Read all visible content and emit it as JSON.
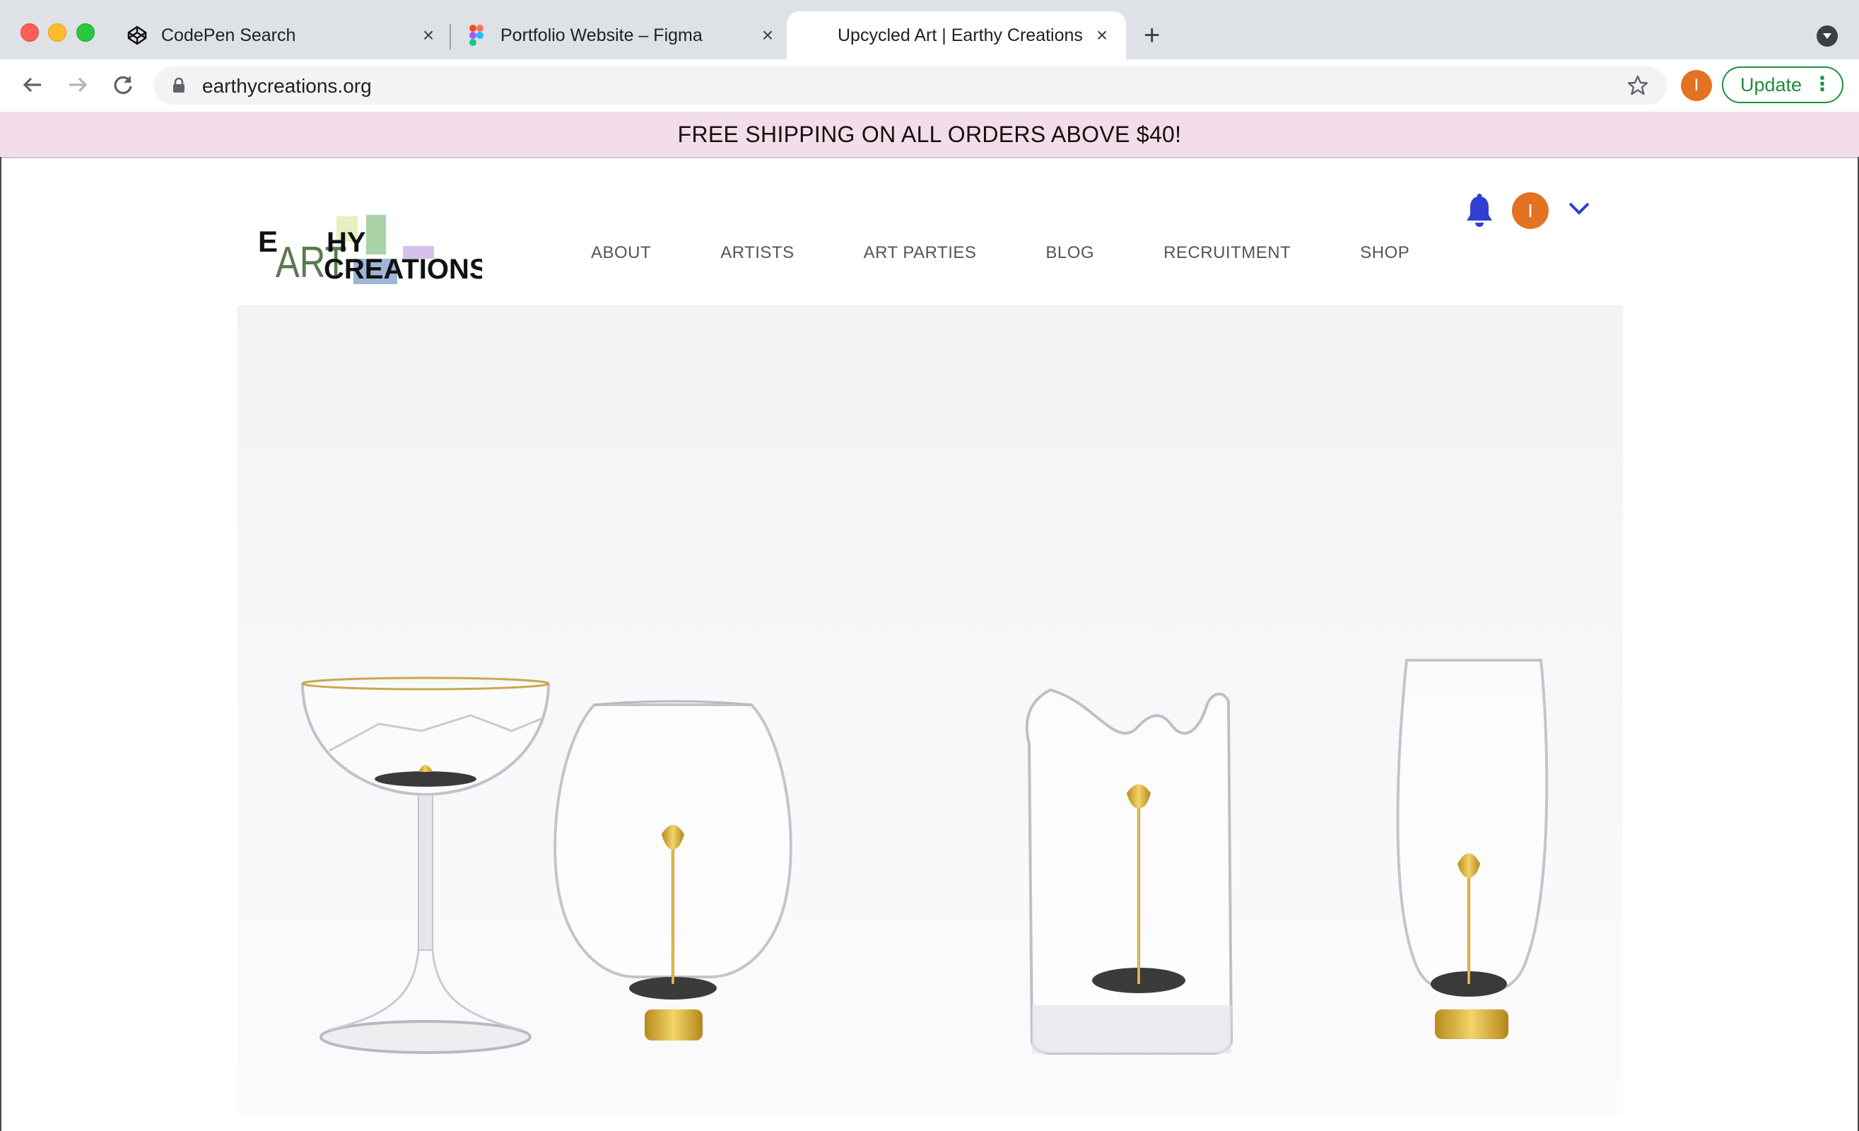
{
  "browser": {
    "tabs": [
      {
        "title": "CodePen Search",
        "favicon": "codepen-icon"
      },
      {
        "title": "Portfolio Website – Figma",
        "favicon": "figma-icon"
      },
      {
        "title": "Upcycled Art | Earthy Creations",
        "favicon": "none",
        "active": true
      }
    ],
    "url": "earthycreations.org",
    "profile_initial": "I",
    "update_label": "Update",
    "colors": {
      "accent_green": "#1e8e3e",
      "profile_orange": "#e37222"
    }
  },
  "site": {
    "banner": "FREE SHIPPING ON ALL ORDERS ABOVE $40!",
    "logo": {
      "line1_left": "E",
      "line1_art": "ART",
      "line1_right": "HY",
      "line2": "CREATIONS"
    },
    "nav": [
      "ABOUT",
      "ARTISTS",
      "ART PARTIES",
      "BLOG",
      "RECRUITMENT",
      "SHOP"
    ],
    "user_initial": "I",
    "colors": {
      "banner_bg": "#f3dde8",
      "bell_blue": "#2f3fd1",
      "avatar_orange": "#e37222"
    }
  },
  "hero": {
    "image": "four-broken-glasses-with-gold-flowers"
  }
}
